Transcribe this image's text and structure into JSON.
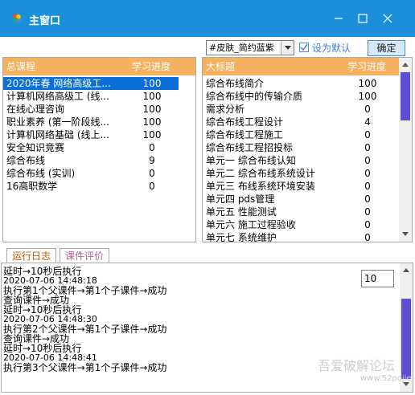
{
  "window": {
    "title": "主窗口",
    "icons": [
      "app-logo-icon",
      "minimize-icon",
      "maximize-icon",
      "close-icon"
    ],
    "accent": "#1c8fdc"
  },
  "toolbar": {
    "skin_select": "#皮肤_简约蓝紫",
    "set_default_label": "设为默认",
    "confirm_label": "确定"
  },
  "left_table": {
    "headers": [
      "总课程",
      "学习进度"
    ],
    "rows": [
      {
        "name": "2020年春 网络高级工...",
        "progress": "100",
        "selected": true
      },
      {
        "name": "计算机网络高级工 (线...",
        "progress": "100"
      },
      {
        "name": "在线心理咨询",
        "progress": "100"
      },
      {
        "name": "职业素养 (第一阶段线...",
        "progress": "100"
      },
      {
        "name": "计算机网络基础 (线上...",
        "progress": "100"
      },
      {
        "name": "安全知识竞赛",
        "progress": "0"
      },
      {
        "name": "综合布线",
        "progress": "9"
      },
      {
        "name": "综合布线 (实训)",
        "progress": "0"
      },
      {
        "name": "16高职数学",
        "progress": "0"
      }
    ]
  },
  "right_table": {
    "headers": [
      "大标题",
      "学习进度"
    ],
    "rows": [
      {
        "name": "综合布线简介",
        "progress": "100"
      },
      {
        "name": "综合布线中的传输介质",
        "progress": "100"
      },
      {
        "name": "需求分析",
        "progress": "0"
      },
      {
        "name": "综合布线工程设计",
        "progress": "4"
      },
      {
        "name": "综合布线工程施工",
        "progress": "0"
      },
      {
        "name": "综合布线工程招投标",
        "progress": "0"
      },
      {
        "name": "单元一 综合布线认知",
        "progress": "0"
      },
      {
        "name": "单元二 综合布线系统设计",
        "progress": "0"
      },
      {
        "name": "单元三 布线系统环境安装",
        "progress": "0"
      },
      {
        "name": "单元四 pds管理",
        "progress": "0"
      },
      {
        "name": "单元五 性能测试",
        "progress": "0"
      },
      {
        "name": "单元六 施工过程验收",
        "progress": "0"
      },
      {
        "name": "单元七 系统维护",
        "progress": "0"
      }
    ]
  },
  "tabs": [
    "运行日志",
    "课件评价"
  ],
  "log": {
    "lines": [
      "延时→10秒后执行",
      "2020-07-06 14:48:18",
      "执行第1个父课件→第1个子课件→成功",
      "查询课件→成功",
      "延时→10秒后执行",
      "2020-07-06 14:48:30",
      "执行第2个父课件→第1个子课件→成功",
      "查询课件→成功",
      "延时→10秒后执行",
      "2020-07-06 14:48:41",
      "执行第3个父课件→第1个子课件→成功"
    ],
    "delay_value": "10"
  },
  "watermark": {
    "line1": "吾爱破解论坛",
    "line2": "www.52pojie.cn"
  }
}
